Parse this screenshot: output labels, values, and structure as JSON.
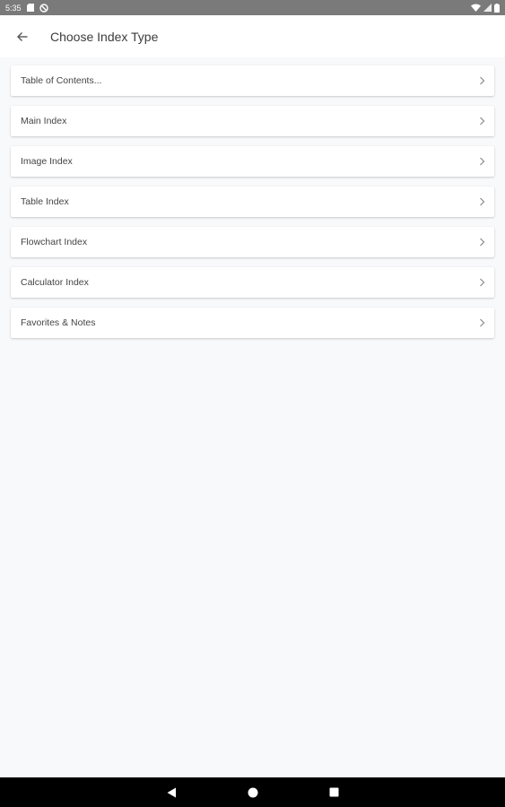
{
  "status_bar": {
    "time": "5:35",
    "icons": [
      "sd-card-icon",
      "no-sync-icon",
      "wifi-icon",
      "signal-icon",
      "battery-icon"
    ]
  },
  "app_bar": {
    "title": "Choose Index Type",
    "back_icon": "arrow-left-icon"
  },
  "index_types": [
    {
      "label": "Table of Contents..."
    },
    {
      "label": "Main Index"
    },
    {
      "label": "Image Index"
    },
    {
      "label": "Table Index"
    },
    {
      "label": "Flowchart Index"
    },
    {
      "label": "Calculator Index"
    },
    {
      "label": "Favorites & Notes"
    }
  ],
  "nav_bar": {
    "buttons": [
      "back-triangle-icon",
      "home-circle-icon",
      "recents-square-icon"
    ]
  },
  "colors": {
    "status_bar": "#7a7a7a",
    "background": "#f8f9fa",
    "card": "#ffffff",
    "nav_bar": "#000000"
  }
}
